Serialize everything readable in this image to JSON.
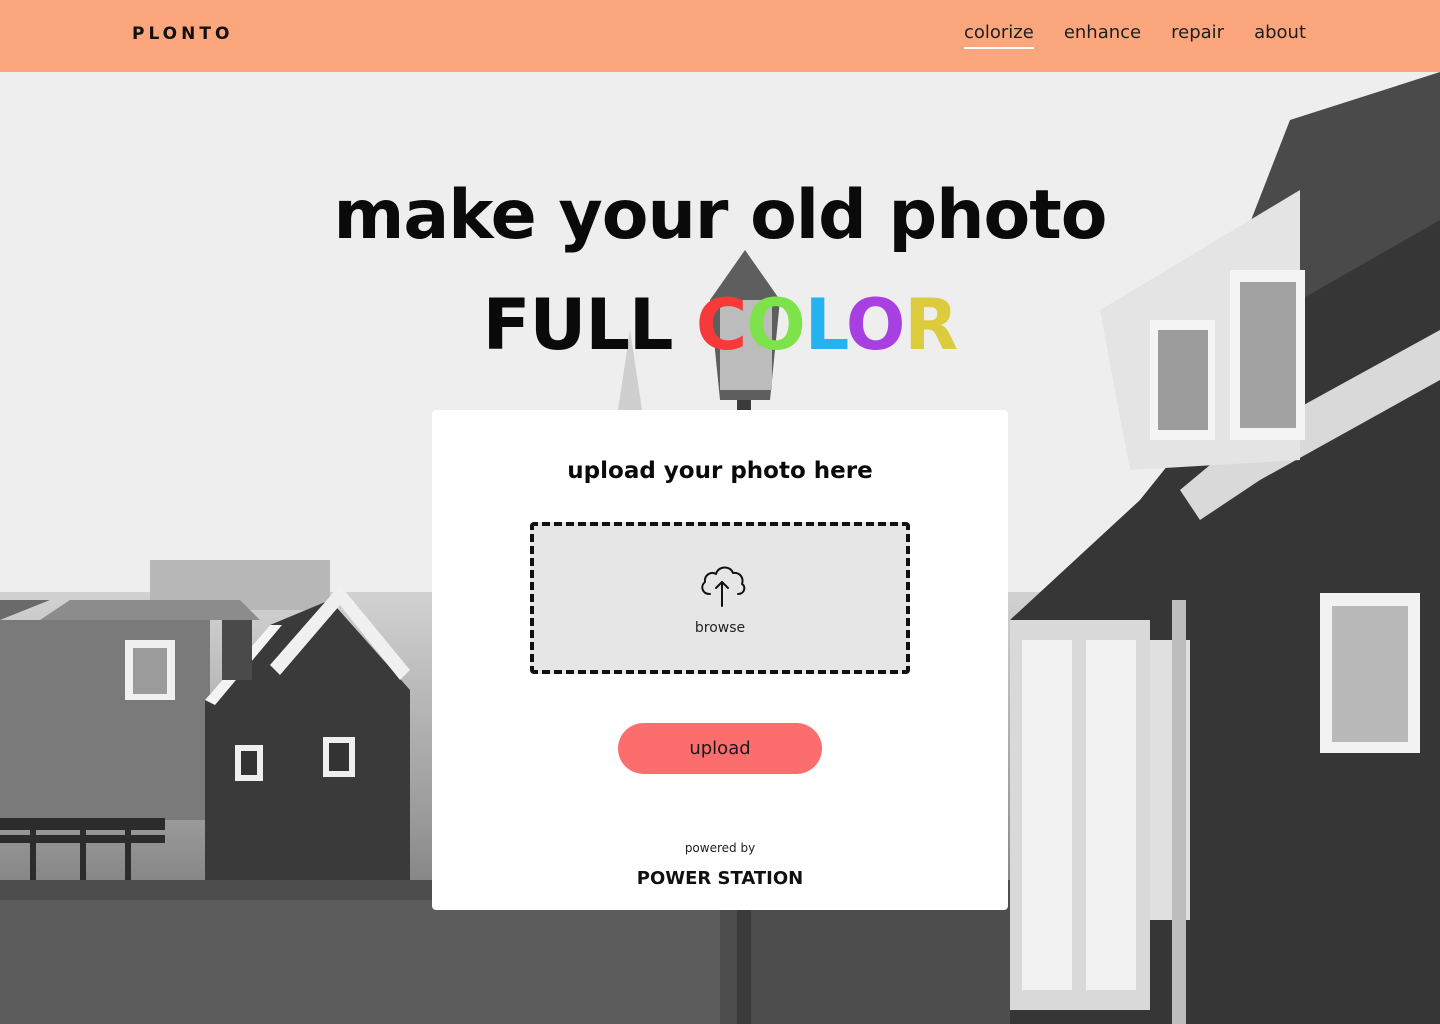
{
  "header": {
    "logo": "PLONTO",
    "nav": [
      {
        "label": "colorize",
        "active": true
      },
      {
        "label": "enhance",
        "active": false
      },
      {
        "label": "repair",
        "active": false
      },
      {
        "label": "about",
        "active": false
      }
    ]
  },
  "hero": {
    "line1": "make your old photo",
    "line2_prefix": "FULL",
    "line2_letters": [
      "C",
      "O",
      "L",
      "O",
      "R"
    ],
    "letter_colors": [
      "#f63a3a",
      "#7ee34a",
      "#22b3f0",
      "#a83fe0",
      "#dccb3c"
    ]
  },
  "card": {
    "title": "upload your photo here",
    "dropzone_label": "browse",
    "dropzone_icon": "cloud-upload-icon",
    "upload_button": "upload",
    "powered_by": "powered by",
    "brand": "POWER STATION"
  },
  "colors": {
    "header_bg": "#fca67e",
    "button_bg": "#fc6d6d",
    "dropzone_bg": "#e6e6e6"
  }
}
